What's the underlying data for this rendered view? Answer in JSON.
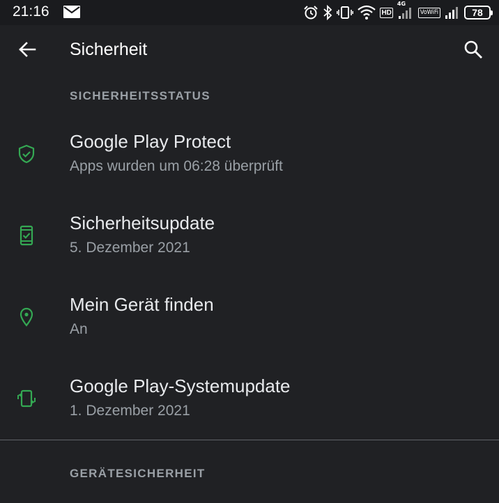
{
  "status_bar": {
    "time": "21:16",
    "hd_label": "HD",
    "network_label": "4G",
    "vowifi_label": "VoWiFi",
    "battery_level": "78",
    "icons": [
      "mail-icon",
      "alarm-icon",
      "bluetooth-icon",
      "vibrate-icon",
      "wifi-icon",
      "signal-icon"
    ]
  },
  "toolbar": {
    "title": "Sicherheit"
  },
  "sections": {
    "status_header": "SICHERHEITSSTATUS",
    "device_header": "GERÄTESICHERHEIT"
  },
  "items": [
    {
      "title": "Google Play Protect",
      "summary": "Apps wurden um 06:28 überprüft",
      "icon": "shield-check-icon"
    },
    {
      "title": "Sicherheitsupdate",
      "summary": "5. Dezember 2021",
      "icon": "phone-check-icon"
    },
    {
      "title": "Mein Gerät finden",
      "summary": "An",
      "icon": "location-pin-icon"
    },
    {
      "title": "Google Play-Systemupdate",
      "summary": "1. Dezember 2021",
      "icon": "system-update-icon"
    }
  ],
  "colors": {
    "background": "#202124",
    "accent_green": "#34a853",
    "text_primary": "#e8eaed",
    "text_secondary": "#9aa0a6"
  }
}
